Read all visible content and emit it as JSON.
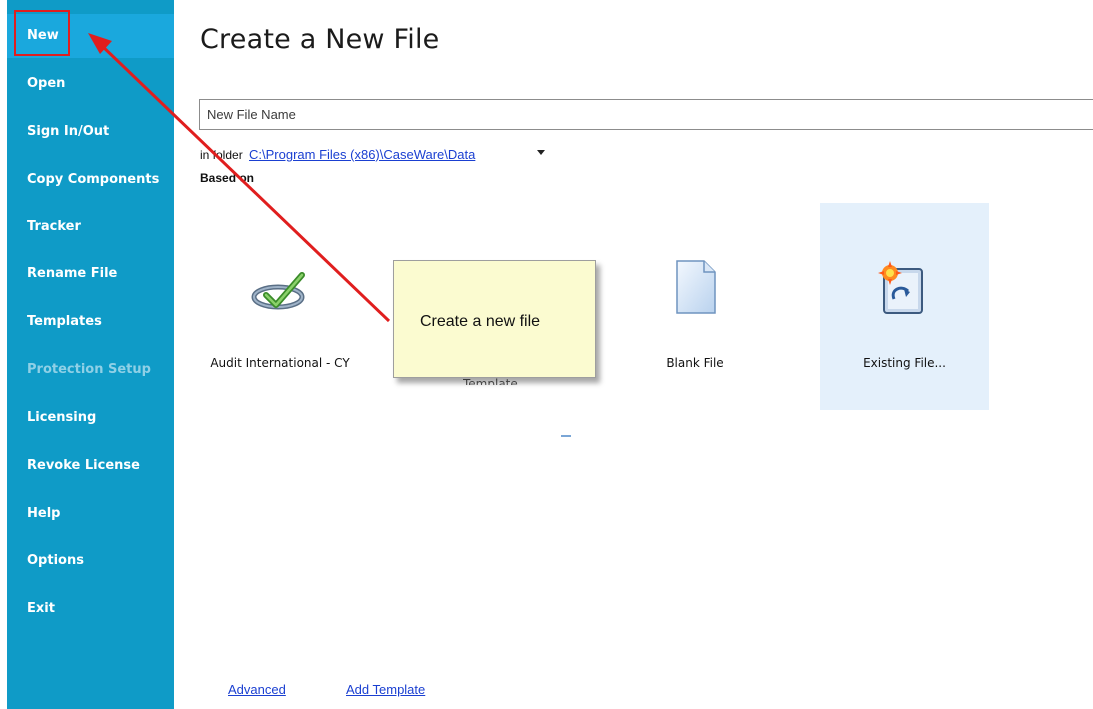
{
  "sidebar": {
    "items": [
      {
        "label": "New"
      },
      {
        "label": "Open"
      },
      {
        "label": "Sign In/Out"
      },
      {
        "label": "Copy Components"
      },
      {
        "label": "Tracker"
      },
      {
        "label": "Rename File"
      },
      {
        "label": "Templates"
      },
      {
        "label": "Protection Setup"
      },
      {
        "label": "Licensing"
      },
      {
        "label": "Revoke License"
      },
      {
        "label": "Help"
      },
      {
        "label": "Options"
      },
      {
        "label": "Exit"
      }
    ]
  },
  "main": {
    "title": "Create a New File",
    "file_name_placeholder": "New File Name",
    "folder_label": "in folder",
    "folder_path": "C:\\Program Files (x86)\\CaseWare\\Data",
    "based_on_label": "Based on",
    "templates": [
      {
        "label": "Audit International - CY",
        "icon": "checkmark-icon"
      },
      {
        "label": "Template",
        "icon": "template-icon"
      },
      {
        "label": "Blank File",
        "icon": "blank-document-icon"
      },
      {
        "label": "Existing File...",
        "icon": "existing-file-icon"
      }
    ]
  },
  "callout": {
    "text": "Create a new file"
  },
  "footer": {
    "advanced": "Advanced",
    "add_template": "Add Template"
  },
  "colors": {
    "sidebar": "#0f9bc7",
    "annotation": "#e01e1e",
    "link": "#1a3fd1",
    "callout": "#fbfbd0",
    "selected_tile": "#e4f0fb"
  }
}
